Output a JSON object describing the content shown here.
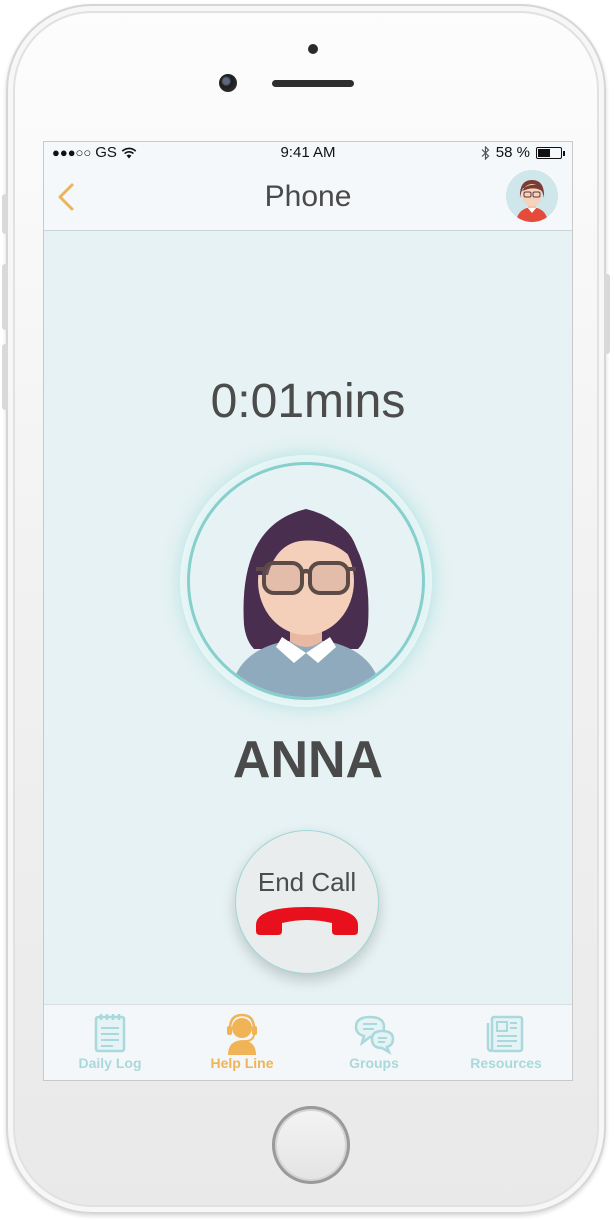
{
  "status_bar": {
    "signal": "●●●○○",
    "carrier": "GS",
    "time": "9:41 AM",
    "battery_text": "58 %",
    "battery_level": 0.58
  },
  "nav": {
    "title": "Phone"
  },
  "call": {
    "timer": "0:01mins",
    "caller_name": "ANNA",
    "end_call_label": "End Call"
  },
  "tabs": [
    {
      "label": "Daily Log",
      "icon": "notepad-icon"
    },
    {
      "label": "Help Line",
      "icon": "headset-agent-icon",
      "active": true
    },
    {
      "label": "Groups",
      "icon": "chat-bubbles-icon"
    },
    {
      "label": "Resources",
      "icon": "newspaper-icon"
    }
  ],
  "colors": {
    "accent": "#f0b356",
    "tab_inactive": "#a9d9dc",
    "screen_bg": "#e6f2f3",
    "ring": "#86cfcd",
    "hangup": "#e8101c"
  }
}
